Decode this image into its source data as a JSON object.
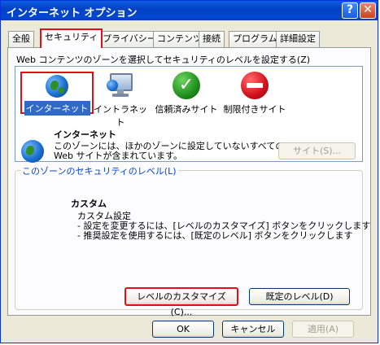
{
  "window": {
    "title": "インターネット オプション",
    "help_glyph": "?",
    "close_glyph": "✕",
    "titlebar_color": "#0a5fe0"
  },
  "tabs": [
    {
      "label": "全般",
      "selected": false
    },
    {
      "label": "セキュリティ",
      "selected": true
    },
    {
      "label": "プライバシー",
      "selected": false
    },
    {
      "label": "コンテンツ",
      "selected": false
    },
    {
      "label": "接続",
      "selected": false
    },
    {
      "label": "プログラム",
      "selected": false
    },
    {
      "label": "詳細設定",
      "selected": false
    }
  ],
  "security": {
    "zone_prompt": "Web コンテンツのゾーンを選択してセキュリティのレベルを設定する(Z)",
    "zones": [
      {
        "label": "インターネット",
        "icon": "globe-icon",
        "selected": true
      },
      {
        "label": "イントラネット",
        "icon": "intranet-computer-icon",
        "selected": false
      },
      {
        "label": "信頼済みサイト",
        "icon": "trusted-check-icon",
        "selected": false
      },
      {
        "label": "制限付きサイト",
        "icon": "restricted-no-entry-icon",
        "selected": false
      }
    ],
    "zone_name": "インターネット",
    "zone_desc_line1": "このゾーンには、ほかのゾーンに設定していないすべての",
    "zone_desc_line2": "Web サイトが含まれています。",
    "sites_button": "サイト(S)...",
    "level_group_title": "このゾーンのセキュリティのレベル(L)",
    "level_name": "カスタム",
    "level_line1": "カスタム設定",
    "level_line2": "- 設定を変更するには、[レベルのカスタマイズ] ボタンをクリックします",
    "level_line3": "- 推奨設定を使用するには、[既定のレベル] ボタンをクリックします",
    "custom_level_button": "レベルのカスタマイズ(C)...",
    "default_level_button": "既定のレベル(D)",
    "highlight_color": "#e0101b"
  },
  "footer": {
    "ok": "OK",
    "cancel": "キャンセル",
    "apply": "適用(A)"
  }
}
